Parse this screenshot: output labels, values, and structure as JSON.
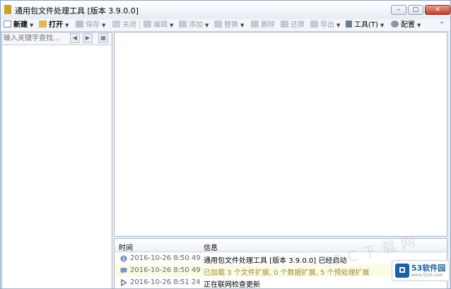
{
  "window": {
    "title": "通用包文件处理工具 [版本 3.9.0.0]",
    "minimize_glyph": "–",
    "maximize_glyph": "□",
    "close_glyph": "✕"
  },
  "toolbar": {
    "new": "新建",
    "open": "打开",
    "save": "保存",
    "close": "关闭",
    "edit": "编辑",
    "add": "添加",
    "replace": "替换",
    "delete": "删除",
    "restore": "还原",
    "export": "导出",
    "tools": "工具(T)",
    "config": "配置"
  },
  "left_panel": {
    "search_placeholder": "输入关键字查找...",
    "prev_glyph": "◀",
    "next_glyph": "▶",
    "options_glyph": "▦"
  },
  "log": {
    "header_time": "时间",
    "header_info": "信息",
    "rows": [
      {
        "time": "2016-10-26 8:50 49",
        "message": "通用包文件处理工具 [版本 3.9.0.0] 已经启动",
        "type": "info"
      },
      {
        "time": "2016-10-26 8:50 49",
        "message": "已加载 3 个文件扩展, 0 个数据扩展, 5 个预处理扩展",
        "type": "warn"
      },
      {
        "time": "2016-10-26 8:51 24",
        "message": "正在联网检查更新",
        "type": "progress"
      }
    ]
  },
  "watermark": {
    "text": "PC下载网",
    "logo_name": "53软件园",
    "logo_url": "www.53xt.com"
  },
  "colors": {
    "accent": "#1d5fa8",
    "warn_text": "#9a8f2a"
  }
}
